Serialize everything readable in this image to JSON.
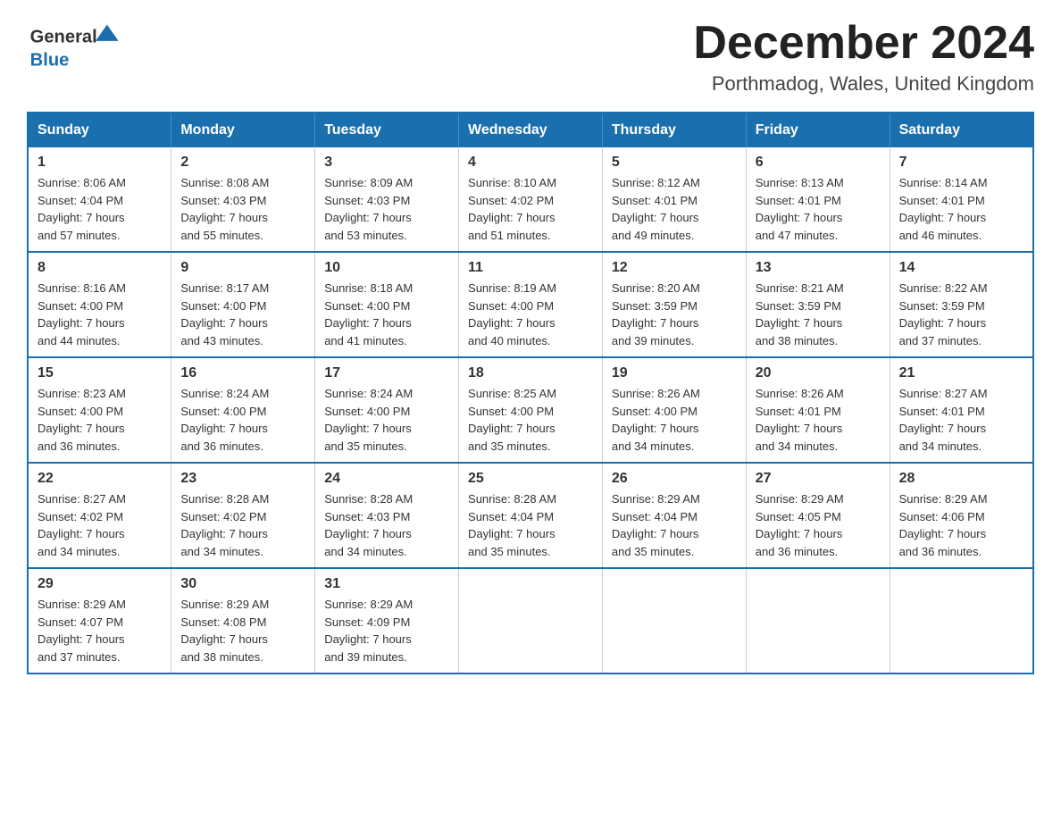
{
  "header": {
    "logo_general": "General",
    "logo_blue": "Blue",
    "month_title": "December 2024",
    "location": "Porthmadog, Wales, United Kingdom"
  },
  "days_of_week": [
    "Sunday",
    "Monday",
    "Tuesday",
    "Wednesday",
    "Thursday",
    "Friday",
    "Saturday"
  ],
  "weeks": [
    [
      {
        "day": "1",
        "sunrise": "8:06 AM",
        "sunset": "4:04 PM",
        "daylight": "7 hours and 57 minutes."
      },
      {
        "day": "2",
        "sunrise": "8:08 AM",
        "sunset": "4:03 PM",
        "daylight": "7 hours and 55 minutes."
      },
      {
        "day": "3",
        "sunrise": "8:09 AM",
        "sunset": "4:03 PM",
        "daylight": "7 hours and 53 minutes."
      },
      {
        "day": "4",
        "sunrise": "8:10 AM",
        "sunset": "4:02 PM",
        "daylight": "7 hours and 51 minutes."
      },
      {
        "day": "5",
        "sunrise": "8:12 AM",
        "sunset": "4:01 PM",
        "daylight": "7 hours and 49 minutes."
      },
      {
        "day": "6",
        "sunrise": "8:13 AM",
        "sunset": "4:01 PM",
        "daylight": "7 hours and 47 minutes."
      },
      {
        "day": "7",
        "sunrise": "8:14 AM",
        "sunset": "4:01 PM",
        "daylight": "7 hours and 46 minutes."
      }
    ],
    [
      {
        "day": "8",
        "sunrise": "8:16 AM",
        "sunset": "4:00 PM",
        "daylight": "7 hours and 44 minutes."
      },
      {
        "day": "9",
        "sunrise": "8:17 AM",
        "sunset": "4:00 PM",
        "daylight": "7 hours and 43 minutes."
      },
      {
        "day": "10",
        "sunrise": "8:18 AM",
        "sunset": "4:00 PM",
        "daylight": "7 hours and 41 minutes."
      },
      {
        "day": "11",
        "sunrise": "8:19 AM",
        "sunset": "4:00 PM",
        "daylight": "7 hours and 40 minutes."
      },
      {
        "day": "12",
        "sunrise": "8:20 AM",
        "sunset": "3:59 PM",
        "daylight": "7 hours and 39 minutes."
      },
      {
        "day": "13",
        "sunrise": "8:21 AM",
        "sunset": "3:59 PM",
        "daylight": "7 hours and 38 minutes."
      },
      {
        "day": "14",
        "sunrise": "8:22 AM",
        "sunset": "3:59 PM",
        "daylight": "7 hours and 37 minutes."
      }
    ],
    [
      {
        "day": "15",
        "sunrise": "8:23 AM",
        "sunset": "4:00 PM",
        "daylight": "7 hours and 36 minutes."
      },
      {
        "day": "16",
        "sunrise": "8:24 AM",
        "sunset": "4:00 PM",
        "daylight": "7 hours and 36 minutes."
      },
      {
        "day": "17",
        "sunrise": "8:24 AM",
        "sunset": "4:00 PM",
        "daylight": "7 hours and 35 minutes."
      },
      {
        "day": "18",
        "sunrise": "8:25 AM",
        "sunset": "4:00 PM",
        "daylight": "7 hours and 35 minutes."
      },
      {
        "day": "19",
        "sunrise": "8:26 AM",
        "sunset": "4:00 PM",
        "daylight": "7 hours and 34 minutes."
      },
      {
        "day": "20",
        "sunrise": "8:26 AM",
        "sunset": "4:01 PM",
        "daylight": "7 hours and 34 minutes."
      },
      {
        "day": "21",
        "sunrise": "8:27 AM",
        "sunset": "4:01 PM",
        "daylight": "7 hours and 34 minutes."
      }
    ],
    [
      {
        "day": "22",
        "sunrise": "8:27 AM",
        "sunset": "4:02 PM",
        "daylight": "7 hours and 34 minutes."
      },
      {
        "day": "23",
        "sunrise": "8:28 AM",
        "sunset": "4:02 PM",
        "daylight": "7 hours and 34 minutes."
      },
      {
        "day": "24",
        "sunrise": "8:28 AM",
        "sunset": "4:03 PM",
        "daylight": "7 hours and 34 minutes."
      },
      {
        "day": "25",
        "sunrise": "8:28 AM",
        "sunset": "4:04 PM",
        "daylight": "7 hours and 35 minutes."
      },
      {
        "day": "26",
        "sunrise": "8:29 AM",
        "sunset": "4:04 PM",
        "daylight": "7 hours and 35 minutes."
      },
      {
        "day": "27",
        "sunrise": "8:29 AM",
        "sunset": "4:05 PM",
        "daylight": "7 hours and 36 minutes."
      },
      {
        "day": "28",
        "sunrise": "8:29 AM",
        "sunset": "4:06 PM",
        "daylight": "7 hours and 36 minutes."
      }
    ],
    [
      {
        "day": "29",
        "sunrise": "8:29 AM",
        "sunset": "4:07 PM",
        "daylight": "7 hours and 37 minutes."
      },
      {
        "day": "30",
        "sunrise": "8:29 AM",
        "sunset": "4:08 PM",
        "daylight": "7 hours and 38 minutes."
      },
      {
        "day": "31",
        "sunrise": "8:29 AM",
        "sunset": "4:09 PM",
        "daylight": "7 hours and 39 minutes."
      },
      null,
      null,
      null,
      null
    ]
  ],
  "labels": {
    "sunrise": "Sunrise:",
    "sunset": "Sunset:",
    "daylight": "Daylight:"
  }
}
